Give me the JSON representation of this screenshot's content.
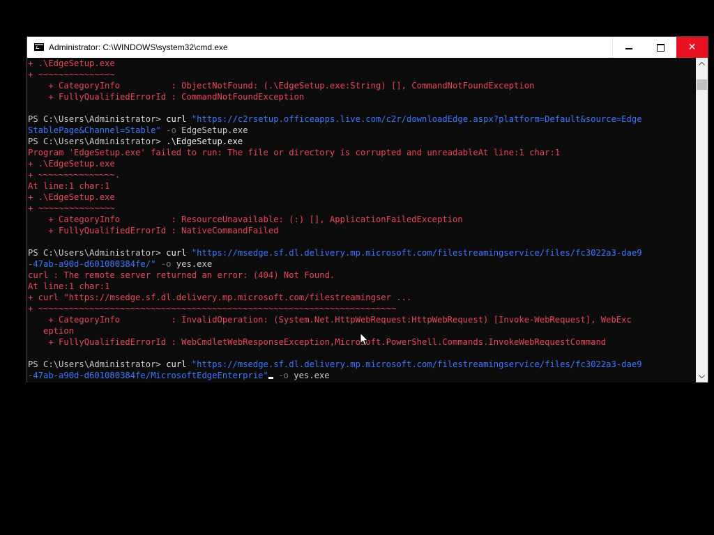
{
  "window": {
    "title": "Administrator: C:\\WINDOWS\\system32\\cmd.exe",
    "icon": "console-app-icon",
    "controls": {
      "minimize": "minimize-icon",
      "maximize": "maximize-icon",
      "close": "✕"
    }
  },
  "colors": {
    "background": "#0c0c0c",
    "default_text": "#cccccc",
    "error_text": "#e74856",
    "cmdlet_text": "#f2f2f2",
    "string_text": "#3b78ff",
    "param_text": "#767676",
    "close_button": "#e81123"
  },
  "console": {
    "lines": [
      [
        {
          "t": "+ .\\EdgeSetup.exe",
          "c": "error_text"
        }
      ],
      [
        {
          "t": "+ ~~~~~~~~~~~~~~~",
          "c": "error_text"
        }
      ],
      [
        {
          "t": "    + CategoryInfo          : ObjectNotFound: (.\\EdgeSetup.exe:String) [], CommandNotFoundException",
          "c": "error_text"
        }
      ],
      [
        {
          "t": "    + FullyQualifiedErrorId : CommandNotFoundException",
          "c": "error_text"
        }
      ],
      [],
      [
        {
          "t": "PS C:\\Users\\Administrator> ",
          "c": "default_text"
        },
        {
          "t": "curl",
          "c": "cmdlet_text"
        },
        {
          "t": " ",
          "c": "default_text"
        },
        {
          "t": "\"https://c2rsetup.officeapps.live.com/c2r/downloadEdge.aspx?platform=Default&source=Edge",
          "c": "string_text"
        }
      ],
      [
        {
          "t": "StablePage&Channel=Stable\"",
          "c": "string_text"
        },
        {
          "t": " ",
          "c": "default_text"
        },
        {
          "t": "-o",
          "c": "param_text"
        },
        {
          "t": " EdgeSetup.exe",
          "c": "default_text"
        }
      ],
      [
        {
          "t": "PS C:\\Users\\Administrator> ",
          "c": "default_text"
        },
        {
          "t": ".\\EdgeSetup.exe",
          "c": "cmdlet_text"
        }
      ],
      [
        {
          "t": "Program 'EdgeSetup.exe' failed to run: The file or directory is corrupted and unreadableAt line:1 char:1",
          "c": "error_text"
        }
      ],
      [
        {
          "t": "+ .\\EdgeSetup.exe",
          "c": "error_text"
        }
      ],
      [
        {
          "t": "+ ~~~~~~~~~~~~~~~.",
          "c": "error_text"
        }
      ],
      [
        {
          "t": "At line:1 char:1",
          "c": "error_text"
        }
      ],
      [
        {
          "t": "+ .\\EdgeSetup.exe",
          "c": "error_text"
        }
      ],
      [
        {
          "t": "+ ~~~~~~~~~~~~~~~",
          "c": "error_text"
        }
      ],
      [
        {
          "t": "    + CategoryInfo          : ResourceUnavailable: (:) [], ApplicationFailedException",
          "c": "error_text"
        }
      ],
      [
        {
          "t": "    + FullyQualifiedErrorId : NativeCommandFailed",
          "c": "error_text"
        }
      ],
      [],
      [
        {
          "t": "PS C:\\Users\\Administrator> ",
          "c": "default_text"
        },
        {
          "t": "curl",
          "c": "cmdlet_text"
        },
        {
          "t": " ",
          "c": "default_text"
        },
        {
          "t": "\"https://msedge.sf.dl.delivery.mp.microsoft.com/filestreamingservice/files/fc3022a3-dae9",
          "c": "string_text"
        }
      ],
      [
        {
          "t": "-47ab-a90d-d601080384fe/\"",
          "c": "string_text"
        },
        {
          "t": " ",
          "c": "default_text"
        },
        {
          "t": "-o",
          "c": "param_text"
        },
        {
          "t": " yes.exe",
          "c": "default_text"
        }
      ],
      [
        {
          "t": "curl : The remote server returned an error: (404) Not Found.",
          "c": "error_text"
        }
      ],
      [
        {
          "t": "At line:1 char:1",
          "c": "error_text"
        }
      ],
      [
        {
          "t": "+ curl \"https://msedge.sf.dl.delivery.mp.microsoft.com/filestreamingser ...",
          "c": "error_text"
        }
      ],
      [
        {
          "t": "+ ~~~~~~~~~~~~~~~~~~~~~~~~~~~~~~~~~~~~~~~~~~~~~~~~~~~~~~~~~~~~~~~~~~~~~~",
          "c": "error_text"
        }
      ],
      [
        {
          "t": "    + CategoryInfo          : InvalidOperation: (System.Net.HttpWebRequest:HttpWebRequest) [Invoke-WebRequest], WebExc",
          "c": "error_text"
        }
      ],
      [
        {
          "t": "   eption",
          "c": "error_text"
        }
      ],
      [
        {
          "t": "    + FullyQualifiedErrorId : WebCmdletWebResponseException,Microsoft.PowerShell.Commands.InvokeWebRequestCommand",
          "c": "error_text"
        }
      ],
      [],
      [
        {
          "t": "PS C:\\Users\\Administrator> ",
          "c": "default_text"
        },
        {
          "t": "curl",
          "c": "cmdlet_text"
        },
        {
          "t": " ",
          "c": "default_text"
        },
        {
          "t": "\"https://msedge.sf.dl.delivery.mp.microsoft.com/filestreamingservice/files/fc3022a3-dae9",
          "c": "string_text"
        }
      ],
      [
        {
          "t": "-47ab-a90d-d601080384fe/MicrosoftEdgeEnterprie",
          "c": "string_text"
        },
        {
          "t": "\"",
          "c": "string_text",
          "cursor": true
        },
        {
          "t": " ",
          "c": "default_text"
        },
        {
          "t": "-o",
          "c": "param_text"
        },
        {
          "t": " yes.exe",
          "c": "default_text"
        }
      ]
    ]
  }
}
